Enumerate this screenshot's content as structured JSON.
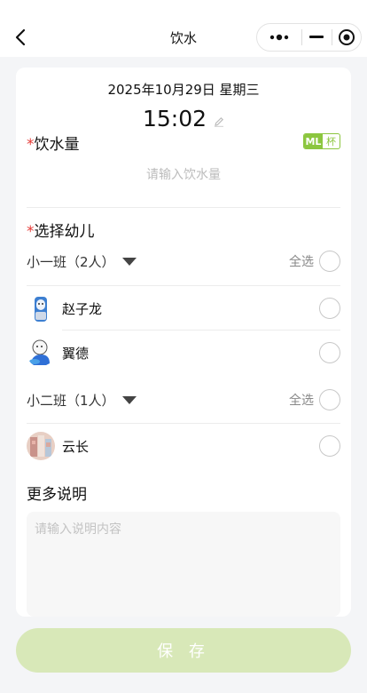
{
  "nav": {
    "title": "饮水",
    "back_icon": "chevron-left-icon",
    "more_icon": "more-dots-icon",
    "minimize_icon": "minimize-icon",
    "close_icon": "target-close-icon"
  },
  "record": {
    "date": "2025年10月29日 星期三",
    "time": "15:02",
    "edit_icon": "pencil-icon"
  },
  "water": {
    "label": "饮水量",
    "required_mark": "*",
    "unit_active": "ML",
    "unit_inactive": "杯",
    "input_value": "",
    "input_placeholder": "请输入饮水量"
  },
  "children": {
    "label": "选择幼儿",
    "required_mark": "*",
    "select_all_label": "全选",
    "classes": [
      {
        "name": "小一班（2人）",
        "students": [
          {
            "name": "赵子龙",
            "selected": false
          },
          {
            "name": "翼德",
            "selected": false
          }
        ]
      },
      {
        "name": "小二班（1人）",
        "students": [
          {
            "name": "云长",
            "selected": false
          }
        ]
      }
    ]
  },
  "notes": {
    "label": "更多说明",
    "value": "",
    "placeholder": "请输入说明内容"
  },
  "actions": {
    "save_label": "保 存"
  },
  "colors": {
    "accent_green": "#8cc63f",
    "save_button_bg": "#d8e8b8",
    "required_red": "#e53935",
    "page_bg": "#f4f5f7"
  }
}
